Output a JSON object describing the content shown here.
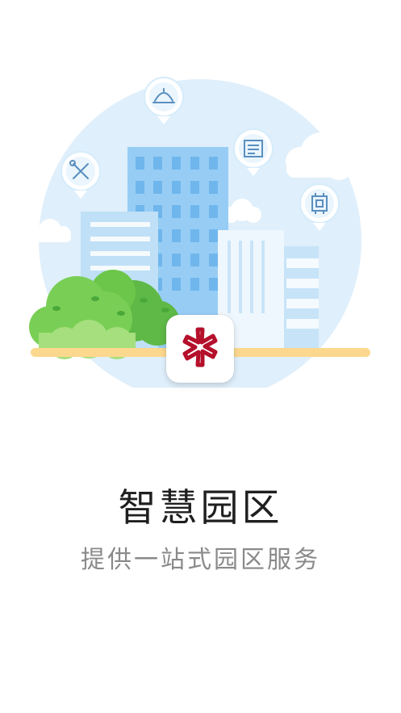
{
  "splash": {
    "title": "智慧园区",
    "subtitle": "提供一站式园区服务"
  },
  "icons": {
    "logo": "asterisk-logo-icon",
    "pins": [
      "tools-icon",
      "service-bell-icon",
      "newspaper-icon",
      "chip-icon"
    ]
  },
  "colors": {
    "logo_red": "#b5102b",
    "sky": "#dceefb",
    "building_blue": "#8cc4f2",
    "bush_green": "#6cc64a",
    "ground": "#fbd68c",
    "title_text": "#1f1f1f",
    "subtitle_text": "#8a8a8a"
  }
}
